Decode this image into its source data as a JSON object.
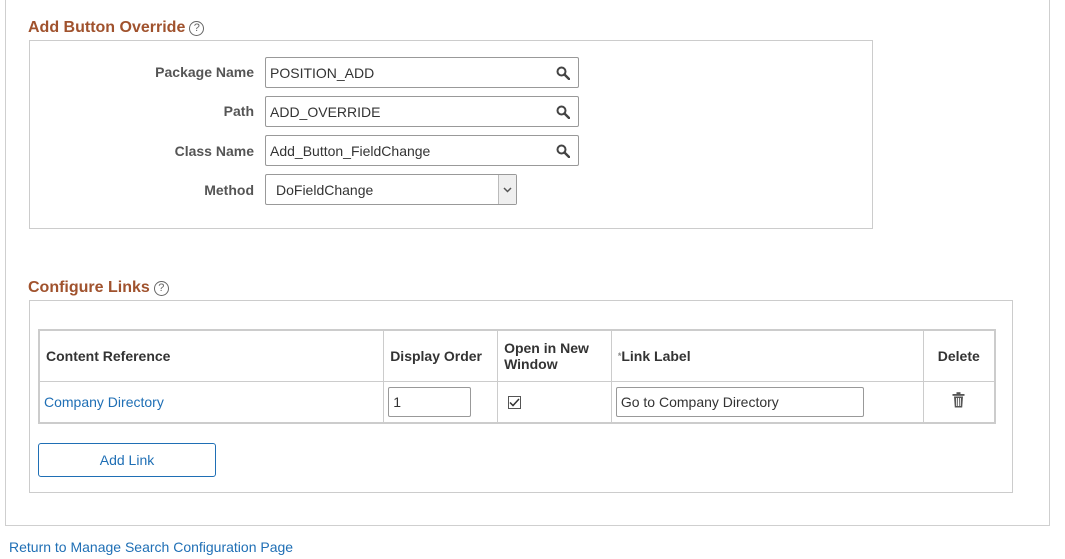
{
  "add_button_override": {
    "title": "Add Button Override",
    "help_glyph": "?",
    "fields": {
      "package_name": {
        "label": "Package Name",
        "value": "POSITION_ADD"
      },
      "path": {
        "label": "Path",
        "value": "ADD_OVERRIDE"
      },
      "class_name": {
        "label": "Class Name",
        "value": "Add_Button_FieldChange"
      },
      "method": {
        "label": "Method",
        "value": "DoFieldChange"
      }
    }
  },
  "configure_links": {
    "title": "Configure Links",
    "help_glyph": "?",
    "columns": {
      "content_reference": "Content Reference",
      "display_order": "Display Order",
      "open_in_new_window": "Open in New Window",
      "link_label_required": "*",
      "link_label": "Link Label",
      "delete": "Delete"
    },
    "rows": [
      {
        "content_reference": "Company Directory",
        "display_order": "1",
        "open_in_new_window": true,
        "link_label": "Go to Company Directory"
      }
    ],
    "add_link_label": "Add Link"
  },
  "footer": {
    "return_link": "Return to Manage Search Configuration Page"
  },
  "colors": {
    "section_title": "#a0522d",
    "link": "#1f6fb5",
    "border": "#cccccc"
  },
  "icons": {
    "lookup": "search-icon",
    "delete": "trash-icon",
    "help": "help-icon",
    "dropdown": "chevron-down-icon",
    "checked": "checkmark-icon"
  }
}
